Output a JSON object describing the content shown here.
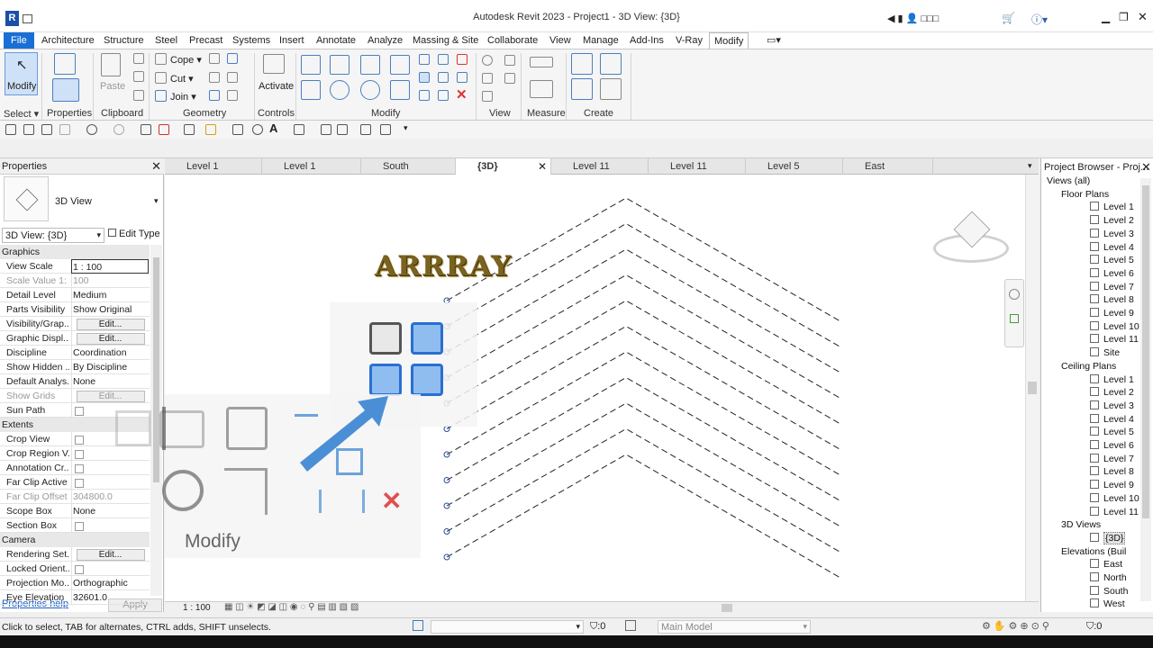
{
  "app": {
    "title": "Autodesk Revit 2023 - Project1 - 3D View: {3D}",
    "logo": "R",
    "user": " □□□"
  },
  "ribbon_tabs": [
    "File",
    "Architecture",
    "Structure",
    "Steel",
    "Precast",
    "Systems",
    "Insert",
    "Annotate",
    "Analyze",
    "Massing & Site",
    "Collaborate",
    "View",
    "Manage",
    "Add-Ins",
    "V-Ray",
    "Modify"
  ],
  "ribbon": {
    "modify_label": "Modify",
    "select_label": "Select",
    "properties_label": "Properties",
    "clipboard_label": "Clipboard",
    "paste_label": "Paste",
    "cope_label": "Cope",
    "cut_label": "Cut",
    "join_label": "Join",
    "geometry_label": "Geometry",
    "activate_label": "Activate",
    "controls_label": "Controls",
    "modify_panel_label": "Modify",
    "view_label": "View",
    "measure_label": "Measure",
    "create_label": "Create"
  },
  "properties": {
    "header": "Properties",
    "type_name": "3D View",
    "type_selector": "3D View: {3D}",
    "edit_type": "Edit Type",
    "graphics_section": "Graphics",
    "rows": [
      {
        "name": "View Scale",
        "value": "1 : 100"
      },
      {
        "name": "Scale Value    1:",
        "value": "100"
      },
      {
        "name": "Detail Level",
        "value": "Medium"
      },
      {
        "name": "Parts Visibility",
        "value": "Show Original"
      },
      {
        "name": "Visibility/Grap...",
        "value": "Edit..."
      },
      {
        "name": "Graphic Displ...",
        "value": "Edit..."
      },
      {
        "name": "Discipline",
        "value": "Coordination"
      },
      {
        "name": "Show Hidden ...",
        "value": "By Discipline"
      },
      {
        "name": "Default Analys...",
        "value": "None"
      },
      {
        "name": "Show Grids",
        "value": "Edit..."
      },
      {
        "name": "Sun Path",
        "value": ""
      }
    ],
    "extents_section": "Extents",
    "extents_rows": [
      {
        "name": "Crop View",
        "value": ""
      },
      {
        "name": "Crop Region V...",
        "value": ""
      },
      {
        "name": "Annotation Cr...",
        "value": ""
      },
      {
        "name": "Far Clip Active",
        "value": ""
      },
      {
        "name": "Far Clip Offset",
        "value": "304800.0"
      },
      {
        "name": "Scope Box",
        "value": "None"
      },
      {
        "name": "Section Box",
        "value": ""
      }
    ],
    "camera_section": "Camera",
    "camera_rows": [
      {
        "name": "Rendering Set...",
        "value": "Edit..."
      },
      {
        "name": "Locked Orient...",
        "value": ""
      },
      {
        "name": "Projection Mo...",
        "value": "Orthographic"
      },
      {
        "name": "Eye Elevation",
        "value": "32601.0"
      }
    ],
    "help_link": "Properties help",
    "apply_button": "Apply"
  },
  "view_tabs": [
    "Level 1",
    "Level 1",
    "South",
    "{3D}",
    "Level 11",
    "Level 11",
    "Level 5",
    "East"
  ],
  "canvas": {
    "overlay_title": "ARRRAY",
    "overlay_panel_label": "Modify",
    "scale_label": "1 : 100"
  },
  "browser": {
    "header": "Project Browser - Proj...",
    "root": "Views (all)",
    "floor_plans": "Floor Plans",
    "floor_levels": [
      "Level 1",
      "Level 2",
      "Level 3",
      "Level 4",
      "Level 5",
      "Level 6",
      "Level 7",
      "Level 8",
      "Level 9",
      "Level 10",
      "Level 11",
      "Site"
    ],
    "ceiling_plans": "Ceiling Plans",
    "ceiling_levels": [
      "Level 1",
      "Level 2",
      "Level 3",
      "Level 4",
      "Level 5",
      "Level 6",
      "Level 7",
      "Level 8",
      "Level 9",
      "Level 10",
      "Level 11"
    ],
    "views_3d": "3D Views",
    "view_3d_item": "{3D}",
    "elevations": "Elevations (Buil",
    "elevation_items": [
      "East",
      "North",
      "South",
      "West"
    ]
  },
  "status": {
    "hint": "Click to select, TAB for alternates, CTRL adds, SHIFT unselects.",
    "counter": ":0",
    "model": "Main Model",
    "filter_count": ":0"
  },
  "colors": {
    "accent": "#1a6fd6",
    "arrow": "#4a8fd6"
  }
}
